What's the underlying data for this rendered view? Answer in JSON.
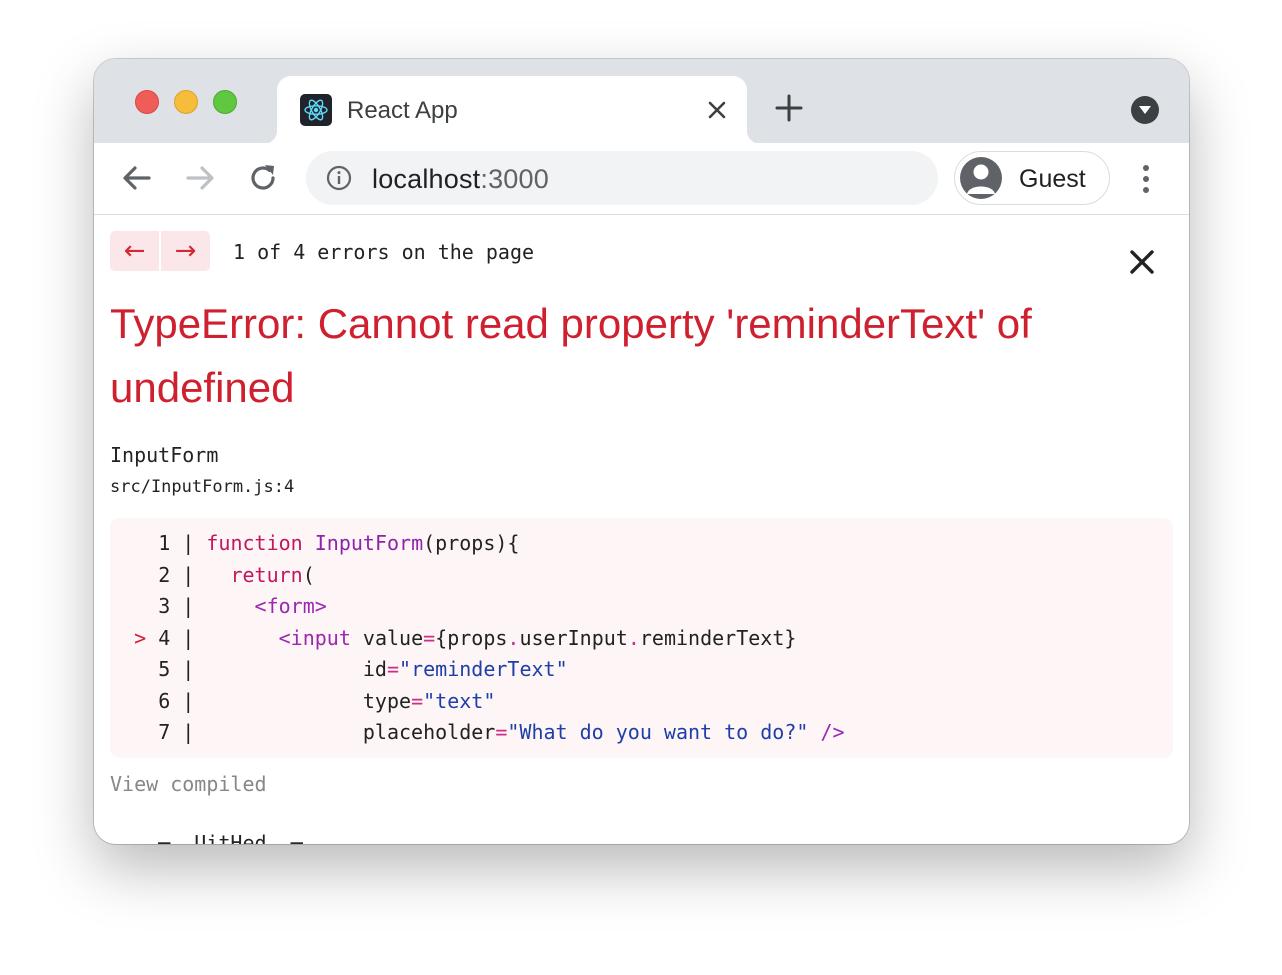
{
  "tab": {
    "title": "React App",
    "favicon": "react-logo-icon"
  },
  "toolbar": {
    "url_host": "localhost",
    "url_port": ":3000",
    "profile_label": "Guest"
  },
  "overlay": {
    "nav_prev": "←",
    "nav_next": "→",
    "error_count": "1 of 4 errors on the page",
    "close": "✕",
    "title": "TypeError: Cannot read property 'reminderText' of undefined",
    "component": "InputForm",
    "location": "src/InputForm.js:4",
    "view_compiled": "View compiled",
    "cutoff_text": "    ─  UitHed  ─"
  },
  "code": {
    "highlighted_line": 4,
    "lines": [
      {
        "number": "1",
        "marker": " ",
        "text": "function InputForm(props){"
      },
      {
        "number": "2",
        "marker": " ",
        "text": "  return("
      },
      {
        "number": "3",
        "marker": " ",
        "text": "    <form>"
      },
      {
        "number": "4",
        "marker": ">",
        "text": "      <input value={props.userInput.reminderText}"
      },
      {
        "number": "5",
        "marker": " ",
        "text": "             id=\"reminderText\""
      },
      {
        "number": "6",
        "marker": " ",
        "text": "             type=\"text\""
      },
      {
        "number": "7",
        "marker": " ",
        "text": "             placeholder=\"What do you want to do?\" />"
      }
    ]
  },
  "colors": {
    "error_red": "#cf2030",
    "code_bg": "#fdf5f6",
    "tab_strip": "#dee1e6"
  }
}
